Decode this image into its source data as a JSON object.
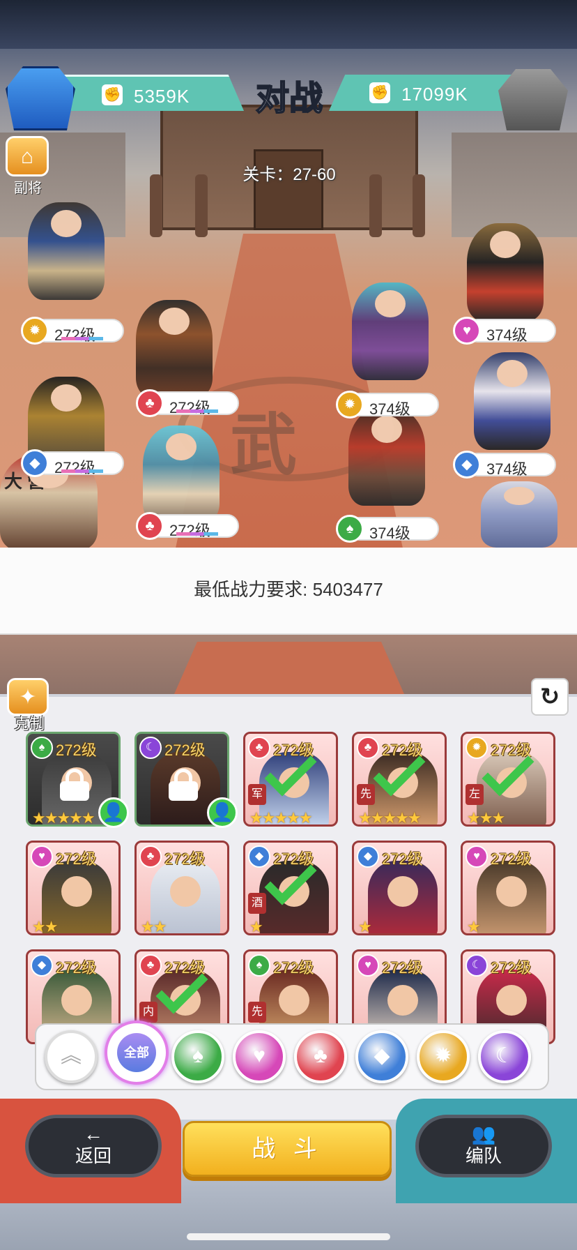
{
  "header": {
    "title": "对战",
    "player_power": "5359K",
    "enemy_power": "17099K",
    "stage": "关卡：27-60"
  },
  "deputy_button": {
    "label": "副将",
    "icon": "pagoda-icon"
  },
  "field": {
    "player_team": [
      {
        "level": "272级",
        "faction": "sun"
      },
      {
        "level": "272级",
        "faction": "clover"
      },
      {
        "level": "272级",
        "faction": "diamond"
      },
      {
        "level": "272级",
        "faction": "clover"
      }
    ],
    "enemy_team": [
      {
        "level": "374级",
        "faction": "heart"
      },
      {
        "level": "374级",
        "faction": "sun"
      },
      {
        "level": "374级",
        "faction": "diamond"
      },
      {
        "level": "374级",
        "faction": "spade"
      }
    ],
    "banner_text": "大 營",
    "floor_emblem": "武"
  },
  "requirement": {
    "text": "最低战力要求: 5403477"
  },
  "counter_button": {
    "label": "克制"
  },
  "roster": [
    {
      "level": "272级",
      "faction": "spade",
      "stars": "★★★★★",
      "locked": true,
      "selected": false,
      "assist": true,
      "tag": ""
    },
    {
      "level": "272级",
      "faction": "moon",
      "stars": "",
      "locked": true,
      "selected": false,
      "assist": true,
      "tag": ""
    },
    {
      "level": "272级",
      "faction": "clover",
      "stars": "★★★★★",
      "locked": false,
      "selected": true,
      "assist": false,
      "tag": "军"
    },
    {
      "level": "272级",
      "faction": "clover",
      "stars": "★★★★★",
      "locked": false,
      "selected": true,
      "assist": false,
      "tag": "先"
    },
    {
      "level": "272级",
      "faction": "sun",
      "stars": "★★★",
      "locked": false,
      "selected": true,
      "assist": false,
      "tag": "左"
    },
    {
      "level": "272级",
      "faction": "heart",
      "stars": "★★",
      "locked": false,
      "selected": false,
      "assist": false,
      "tag": ""
    },
    {
      "level": "272级",
      "faction": "clover",
      "stars": "★★",
      "locked": false,
      "selected": false,
      "assist": false,
      "tag": ""
    },
    {
      "level": "272级",
      "faction": "diamond",
      "stars": "★",
      "locked": false,
      "selected": true,
      "assist": false,
      "tag": "酒"
    },
    {
      "level": "272级",
      "faction": "diamond",
      "stars": "★",
      "locked": false,
      "selected": false,
      "assist": false,
      "tag": ""
    },
    {
      "level": "272级",
      "faction": "heart",
      "stars": "★",
      "locked": false,
      "selected": false,
      "assist": false,
      "tag": ""
    },
    {
      "level": "272级",
      "faction": "diamond",
      "stars": "",
      "locked": false,
      "selected": false,
      "assist": false,
      "tag": ""
    },
    {
      "level": "272级",
      "faction": "clover",
      "stars": "",
      "locked": false,
      "selected": true,
      "assist": false,
      "tag": "内"
    },
    {
      "level": "272级",
      "faction": "spade",
      "stars": "",
      "locked": false,
      "selected": false,
      "assist": false,
      "tag": "先"
    },
    {
      "level": "272级",
      "faction": "heart",
      "stars": "",
      "locked": false,
      "selected": false,
      "assist": false,
      "tag": ""
    },
    {
      "level": "272级",
      "faction": "moon",
      "stars": "",
      "locked": false,
      "selected": false,
      "assist": false,
      "tag": ""
    }
  ],
  "filters": {
    "collapse_icon": "double-chevron-up-icon",
    "all_label": "全部",
    "factions": [
      {
        "name": "spade",
        "color": "#3cab46"
      },
      {
        "name": "heart",
        "color": "#d648b8"
      },
      {
        "name": "clover",
        "color": "#e04450"
      },
      {
        "name": "diamond",
        "color": "#3f7fd8"
      },
      {
        "name": "sun",
        "color": "#e8a820"
      },
      {
        "name": "moon",
        "color": "#8a45d8"
      }
    ]
  },
  "bottom": {
    "back_label": "返回",
    "battle_label": "战 斗",
    "formation_label": "编队"
  },
  "colors": {
    "power_bar": "#5fc4b3",
    "check": "#3ec64b",
    "battle_button": "#f2b01e",
    "left_base": "#d8533f",
    "right_base": "#3fa3b0"
  }
}
